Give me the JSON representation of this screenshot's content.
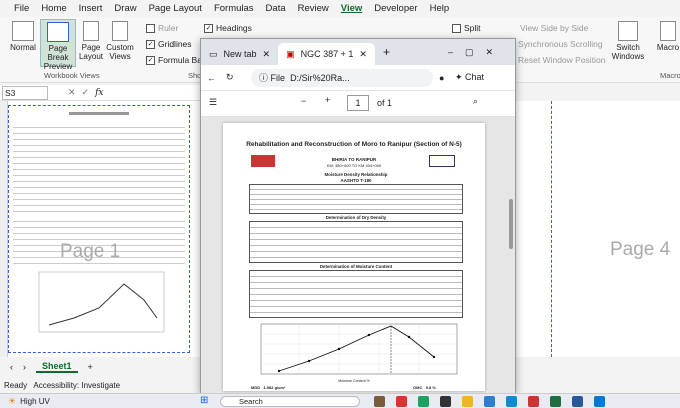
{
  "excel": {
    "menu": [
      "File",
      "Home",
      "Insert",
      "Draw",
      "Page Layout",
      "Formulas",
      "Data",
      "Review",
      "View",
      "Developer",
      "Help"
    ],
    "active_menu": "View",
    "ribbon": {
      "normal": "Normal",
      "page_break_preview_1": "Page Break",
      "page_break_preview_2": "Preview",
      "page_layout_1": "Page",
      "page_layout_2": "Layout",
      "custom_views_1": "Custom",
      "custom_views_2": "Views",
      "group_workbook_views": "Workbook Views",
      "ruler": "Ruler",
      "gridlines": "Gridlines",
      "formula_bar": "Formula Bar",
      "headings": "Headings",
      "show_group": "Sho",
      "split": "Split",
      "view_side_by_side": "View Side by Side",
      "synchronous_scrolling": "Synchronous Scrolling",
      "reset_window_position": "Reset Window Position",
      "switch_windows_1": "Switch",
      "switch_windows_2": "Windows",
      "macros": "Macro",
      "macros_group": "Macro"
    },
    "name_box": "S3",
    "fx": "fx",
    "sheet_tab": "Sheet1",
    "page_label_1": "Page 1",
    "page_label_4": "Page 4",
    "status_ready": "Ready",
    "accessibility": "Accessibility: Investigate"
  },
  "edge": {
    "tab_new": "New tab",
    "tab_pdf": "NGC 387 + 1",
    "address_label": "File",
    "address": "D:/Sir%20Ra...",
    "chat": "Chat",
    "page_number": "1",
    "page_total": "of 1"
  },
  "pdf": {
    "title": "Rehabilitation and Reconstruction of Moro to Ranipur (Section of N-5)",
    "header1": "BHIRIA TO RANIPUR",
    "header2": "KM: 380+000 TO KM 404+000",
    "section_density": "Moisture Density Relationship",
    "aashto": "AASHTO T-180",
    "dry_density": "Determination of Dry Density",
    "moisture_content": "Determination of Moisture Content",
    "mdd_label": "MDD",
    "mdd_value": "1.982 g/cm³",
    "omc_label": "OMC",
    "omc_value": "9.8 %",
    "x_axis": "Moisture Content %"
  },
  "taskbar": {
    "weather": "High UV",
    "search": "Search"
  },
  "colors": {
    "excel_green": "#0f6b2f",
    "page_break_blue": "#3b5bdb"
  }
}
